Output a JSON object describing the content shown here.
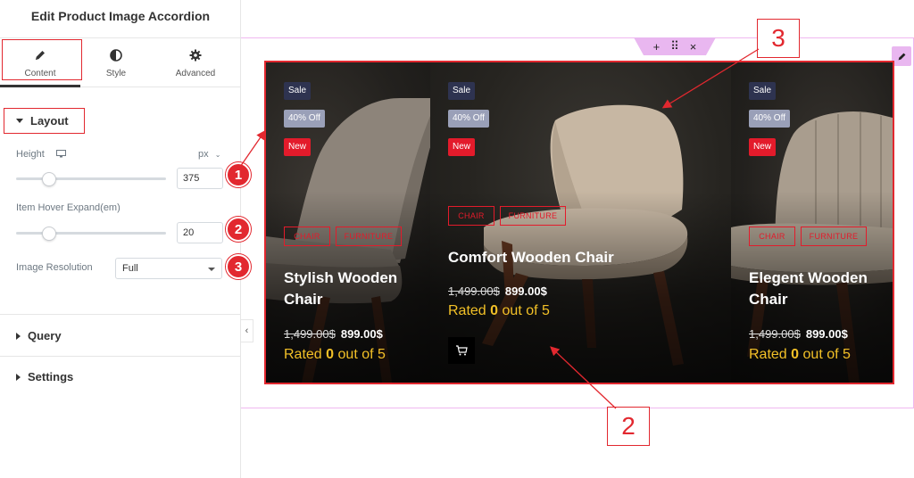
{
  "panel": {
    "title": "Edit Product Image Accordion",
    "tabs": [
      {
        "label": "Content",
        "icon": "pencil-icon"
      },
      {
        "label": "Style",
        "icon": "half-circle-icon"
      },
      {
        "label": "Advanced",
        "icon": "gear-icon"
      }
    ],
    "active_tab": "Content",
    "layout": {
      "heading": "Layout",
      "height_label": "Height",
      "height_unit": "px",
      "height_value": "375",
      "height_slider_fraction": 0.22,
      "hover_label": "Item Hover Expand(em)",
      "hover_value": "20",
      "hover_slider_fraction": 0.22,
      "resolution_label": "Image Resolution",
      "resolution_value": "Full"
    },
    "query_heading": "Query",
    "settings_heading": "Settings"
  },
  "accordion": {
    "items": [
      {
        "name": "Stylish Wooden Chair",
        "badges": [
          "Sale",
          "40% Off",
          "New"
        ],
        "categories": [
          "CHAIR",
          "FURNITURE"
        ],
        "old_price": "1,499.00$",
        "new_price": "899.00$",
        "rating_prefix": "Rated",
        "rating_value": "0",
        "rating_suffix": "out of 5"
      },
      {
        "name": "Comfort Wooden Chair",
        "badges": [
          "Sale",
          "40% Off",
          "New"
        ],
        "categories": [
          "CHAIR",
          "FURNITURE"
        ],
        "old_price": "1,499.00$",
        "new_price": "899.00$",
        "rating_prefix": "Rated",
        "rating_value": "0",
        "rating_suffix": "out of 5",
        "has_cart_button": true
      },
      {
        "name": "Elegent Wooden Chair",
        "badges": [
          "Sale",
          "40% Off",
          "New"
        ],
        "categories": [
          "CHAIR",
          "FURNITURE"
        ],
        "old_price": "1,499.00$",
        "new_price": "899.00$",
        "rating_prefix": "Rated",
        "rating_value": "0",
        "rating_suffix": "out of 5"
      }
    ]
  },
  "section_tools": {
    "add": "+",
    "move": "⠿",
    "close": "×"
  },
  "annotations": {
    "badges": [
      "1",
      "2",
      "3"
    ],
    "callouts": [
      "3",
      "2"
    ]
  },
  "colors": {
    "accent_red": "#e2282f",
    "rating_yellow": "#f2c027",
    "editor_pink": "#e9b7f0"
  }
}
